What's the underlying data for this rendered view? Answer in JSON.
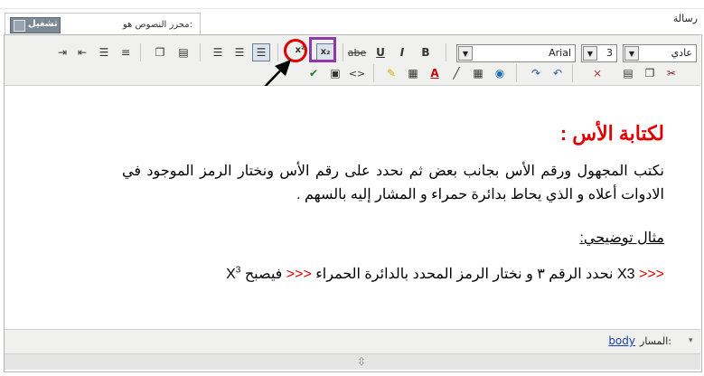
{
  "field_label": "رسالة",
  "editor_tab": {
    "label": "محرر النصوص هو:",
    "toggle_label": "تشغيل"
  },
  "toolbar": {
    "style_select": {
      "value": "عادي"
    },
    "size_select": {
      "value": "3"
    },
    "font_select": {
      "value": "Arial"
    },
    "row1_buttons": [
      "bold-button",
      "italic-button",
      "underline-button",
      "strikethrough-button",
      "subscript-button",
      "superscript-button",
      "align-left-button",
      "align-center-button",
      "align-right-button",
      "new-document-button",
      "template-button",
      "ordered-list-button",
      "unordered-list-button",
      "outdent-button",
      "indent-button"
    ],
    "glyphs": {
      "bold": "B",
      "italic": "I",
      "underline": "U",
      "strike": "abe",
      "subscript": "x₂",
      "superscript": "x²",
      "code": "<>",
      "text_color": "A"
    }
  },
  "content": {
    "heading": "لكتابة الأس :",
    "paragraph": "نكتب المجهول ورقم الأس بجانب بعض ثم نحدد على رقم الأس ونختار الرمز الموجود في الادوات أعلاه و الذي يحاط بدائرة حمراء و المشار إليه بالسهم .",
    "example_label": "مثال توضيحي:",
    "example_line": {
      "before": "X3",
      "arrows1": ">>>",
      "middle": "نحدد الرقم ٣ و نختار الرمز المحدد بالدائرة الحمراء",
      "arrows2": ">>>",
      "after": "فيصبح",
      "result_base": "X",
      "result_exp": "3"
    }
  },
  "status": {
    "path_label": "المسار:",
    "path_value": "body"
  },
  "colors": {
    "highlight_circle": "#e00000",
    "highlight_box": "#8d3aa8",
    "heading": "#e00000",
    "toolbar_bg": "#f0f0ee"
  }
}
